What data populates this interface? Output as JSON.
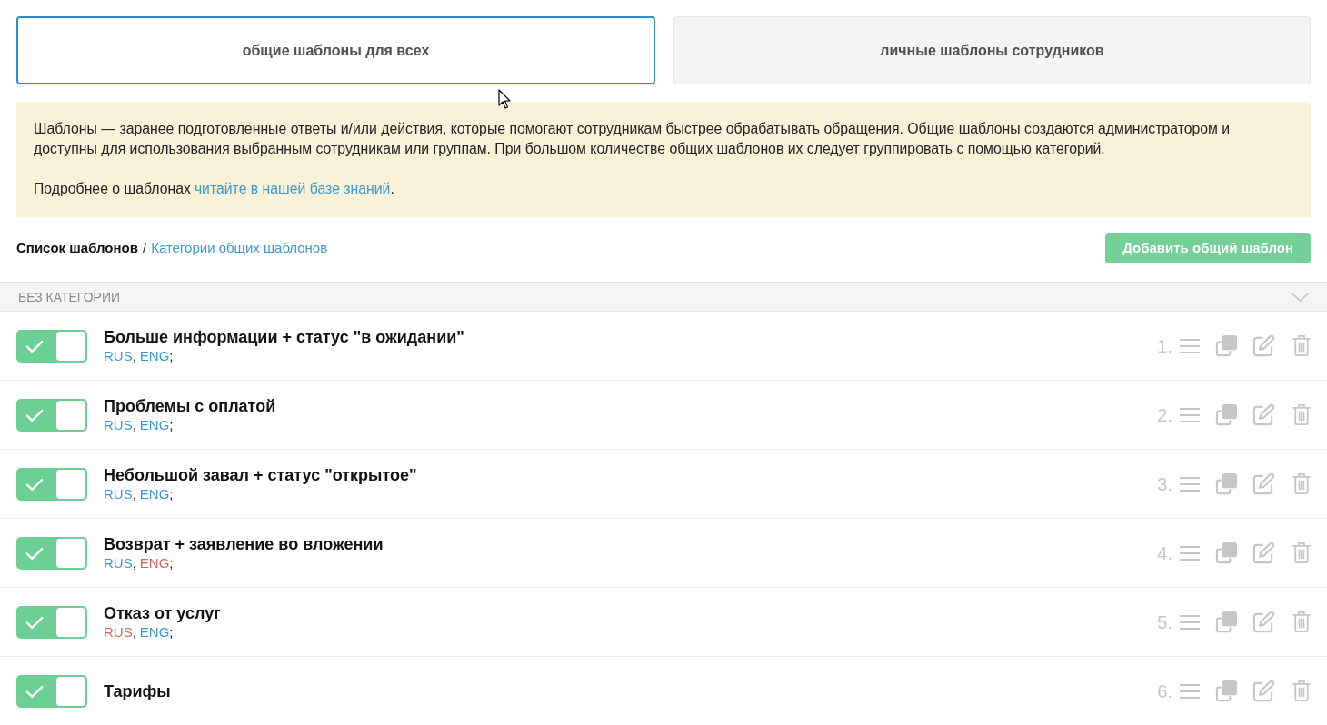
{
  "tabs": [
    {
      "label": "общие шаблоны для всех",
      "selected": true
    },
    {
      "label": "личные шаблоны сотрудников",
      "selected": false
    }
  ],
  "info": {
    "paragraph": "Шаблоны — заранее подготовленные ответы и/или действия, которые помогают сотрудникам быстрее обрабатывать обращения. Общие шаблоны создаются администратором и доступны для использования выбранным сотрудникам или группам. При большом количестве общих шаблонов их следует группировать с помощью категорий.",
    "more": {
      "text": "Подробнее о шаблонах",
      "link": "читайте в нашей базе знаний",
      "end": "."
    }
  },
  "breadcrumb": {
    "current": "Список шаблонов",
    "separator": "/",
    "link": "Категории общих шаблонов"
  },
  "add_button": "Добавить общий шаблон",
  "category": {
    "title": "БЕЗ КАТЕГОРИИ",
    "templates": [
      {
        "on": true,
        "title": "Больше информации + статус \"в ожидании\"",
        "languages": [
          {
            "code": "RUS",
            "color": "#3d9ad1",
            "after": ","
          },
          {
            "code": "ENG",
            "color": "#3d9ad1",
            "after": ";"
          }
        ],
        "number": "1."
      },
      {
        "on": true,
        "title": "Проблемы с оплатой",
        "languages": [
          {
            "code": "RUS",
            "color": "#3d9ad1",
            "after": ","
          },
          {
            "code": "ENG",
            "color": "#3d9ad1",
            "after": ";"
          }
        ],
        "number": "2."
      },
      {
        "on": true,
        "title": "Небольшой завал + статус \"открытое\"",
        "languages": [
          {
            "code": "RUS",
            "color": "#3d9ad1",
            "after": ","
          },
          {
            "code": "ENG",
            "color": "#3d9ad1",
            "after": ";"
          }
        ],
        "number": "3."
      },
      {
        "on": true,
        "title": "Возврат + заявление во вложении",
        "languages": [
          {
            "code": "RUS",
            "color": "#3d9ad1",
            "after": ","
          },
          {
            "code": "ENG",
            "color": "#d9645e",
            "after": ";"
          }
        ],
        "number": "4."
      },
      {
        "on": true,
        "title": "Отказ от услуг",
        "languages": [
          {
            "code": "RUS",
            "color": "#d9645e",
            "after": ","
          },
          {
            "code": "ENG",
            "color": "#3d9ad1",
            "after": ";"
          }
        ],
        "number": "5."
      },
      {
        "on": true,
        "title": "Тарифы",
        "number": "6."
      }
    ]
  }
}
